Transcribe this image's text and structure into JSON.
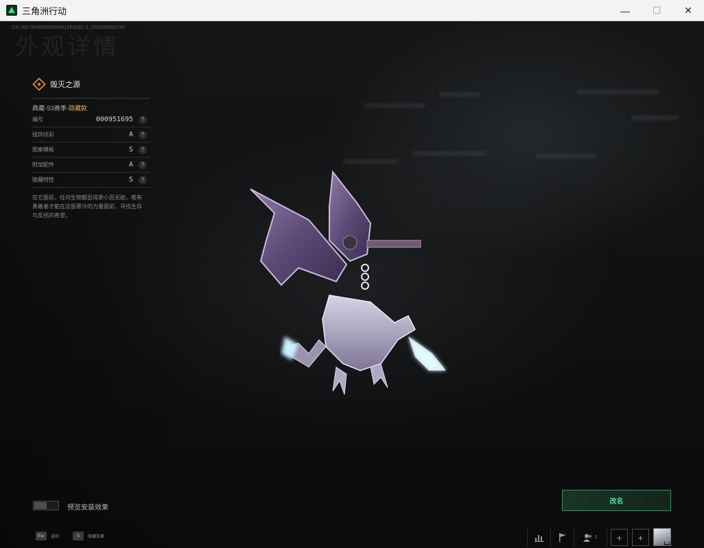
{
  "window": {
    "title": "三角洲行动",
    "minimize": "—",
    "maximize": "☐",
    "close": "✕"
  },
  "header": {
    "uid": "CN UID:9048505839841053292 2_20260926174​0",
    "page_title": "外观详情"
  },
  "item": {
    "name": "毁灭之源",
    "season_prefix": "典藏-S3赛季-",
    "season_tag": "隐藏款",
    "attributes": [
      {
        "label": "编号",
        "value": "000951695"
      },
      {
        "label": "挂饰炫彩",
        "value": "A"
      },
      {
        "label": "图案模板",
        "value": "S"
      },
      {
        "label": "附加配件",
        "value": "A"
      },
      {
        "label": "隐藏特性",
        "value": "S"
      }
    ],
    "help_glyph": "?",
    "description": "在它面前，任何生物都显得渺小而无助，唯有勇敢者才能在这股寒冷的力量面前，寻找生存与反抗的希望。"
  },
  "preview": {
    "toggle_label": "预览安装效果",
    "toggle_on": false
  },
  "actions": {
    "rename_label": "改名"
  },
  "hints": [
    {
      "key": "Esc",
      "text": "返回"
    },
    {
      "key": "S",
      "text": "隐藏效果"
    }
  ],
  "bottom_bar": {
    "friend_count": "2",
    "avatar_level": "60"
  },
  "colors": {
    "accent_green": "#4ee08f",
    "rarity_orange": "#d7793a",
    "hidden_gold": "#d8b254"
  }
}
